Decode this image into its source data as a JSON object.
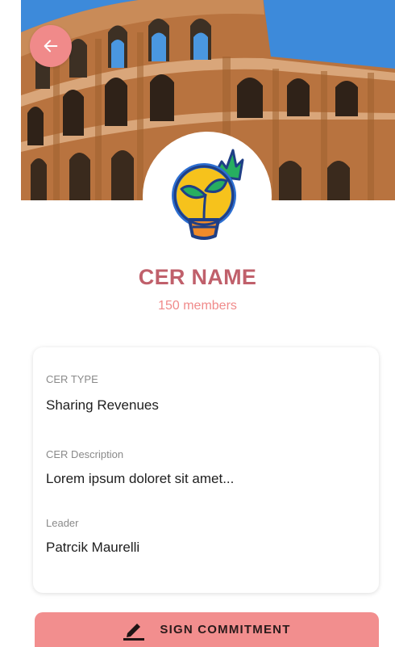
{
  "header": {
    "back_icon": "arrow-left-icon",
    "hero_image": "colosseum-photo"
  },
  "community": {
    "avatar_icon": "lightbulb-sprout-icon",
    "name": "CER NAME",
    "members": "150 members"
  },
  "details": {
    "fields": [
      {
        "label": "CER TYPE",
        "value": "Sharing Revenues"
      },
      {
        "label": "CER Description",
        "value": "Lorem ipsum doloret sit amet..."
      },
      {
        "label": "Leader",
        "value": "Patrcik Maurelli"
      }
    ]
  },
  "actions": {
    "sign_label": "SIGN COMMITMENT",
    "sign_icon": "pen-icon"
  },
  "colors": {
    "accent": "#f28e8e",
    "title": "#c0606b",
    "subtitle": "#f08a8a"
  }
}
